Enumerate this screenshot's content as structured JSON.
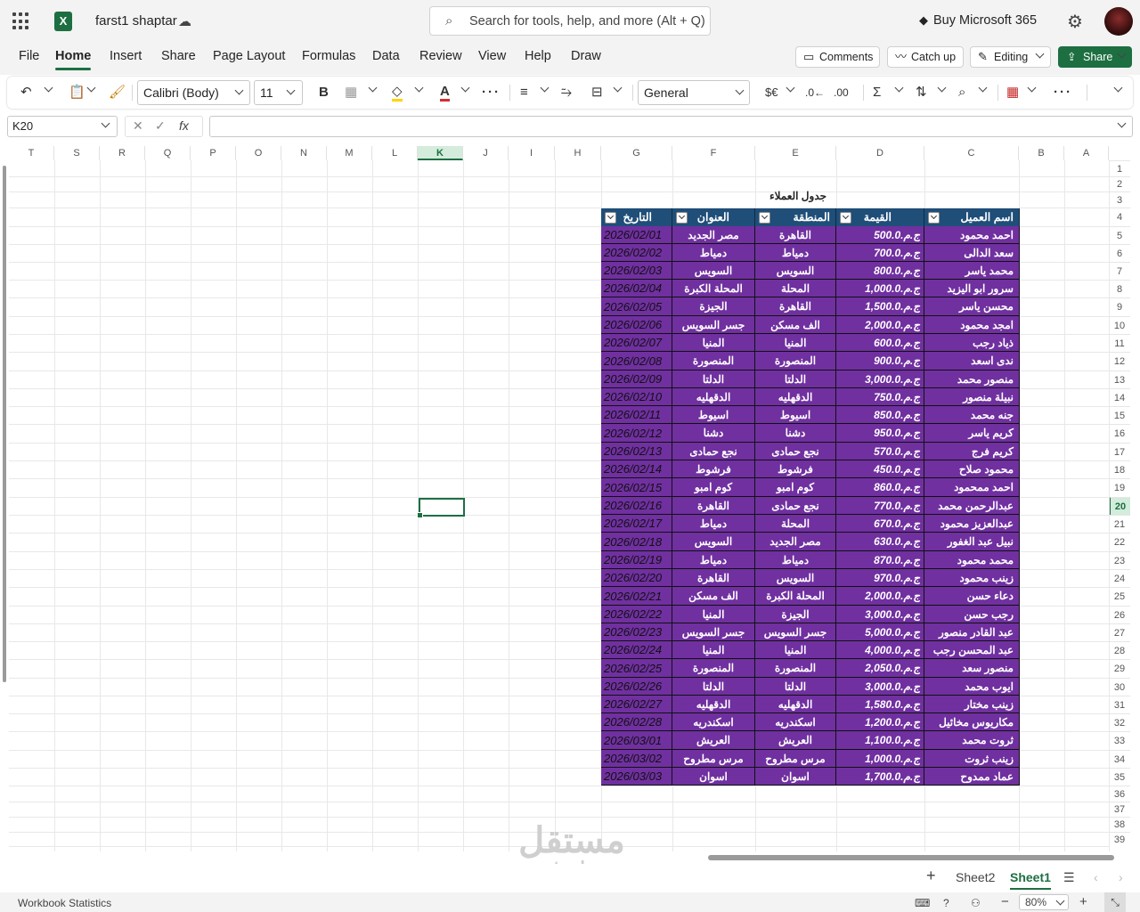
{
  "titlebar": {
    "doc_title": "farst1 shaptar",
    "search_placeholder": "Search for tools, help, and more (Alt + Q)",
    "buy_label": "Buy Microsoft 365"
  },
  "menu": {
    "items": [
      "File",
      "Home",
      "Insert",
      "Share",
      "Page Layout",
      "Formulas",
      "Data",
      "Review",
      "View",
      "Help",
      "Draw"
    ],
    "active": "Home",
    "comments_label": "Comments",
    "catchup_label": "Catch up",
    "editing_label": "Editing",
    "share_label": "Share"
  },
  "ribbon": {
    "font_name": "Calibri (Body)",
    "font_size": "11",
    "number_format": "General",
    "currency_glyph": "$€"
  },
  "formula_bar": {
    "name_box": "K20",
    "fx_label": "fx",
    "formula": ""
  },
  "grid": {
    "columns": [
      "T",
      "S",
      "R",
      "Q",
      "P",
      "O",
      "N",
      "M",
      "L",
      "K",
      "J",
      "I",
      "H",
      "G",
      "F",
      "E",
      "D",
      "C",
      "B",
      "A"
    ],
    "selected_column": "K",
    "row_count": 39,
    "selected_row": "20"
  },
  "table": {
    "title": "جدول العملاء",
    "headers": {
      "c": "اسم العميل",
      "d": "القيمة",
      "e": "المنطقة",
      "f": "العنوان",
      "g": "التاريخ"
    },
    "rows": [
      {
        "name": "احمد محمود",
        "value": "ج.م.500.0",
        "region": "القاهرة",
        "address": "مصر الجديد",
        "date": "2026/02/01"
      },
      {
        "name": "سعد الدالى",
        "value": "ج.م.700.0",
        "region": "دمياط",
        "address": "دمياط",
        "date": "2026/02/02"
      },
      {
        "name": "محمد ياسر",
        "value": "ج.م.800.0",
        "region": "السويس",
        "address": "السويس",
        "date": "2026/02/03"
      },
      {
        "name": "سرور ابو اليزيد",
        "value": "ج.م.1,000.0",
        "region": "المحلة",
        "address": "المحلة الكبرة",
        "date": "2026/02/04"
      },
      {
        "name": "محسن ياسر",
        "value": "ج.م.1,500.0",
        "region": "القاهرة",
        "address": "الجيزة",
        "date": "2026/02/05"
      },
      {
        "name": "امجد محمود",
        "value": "ج.م.2,000.0",
        "region": "الف مسكن",
        "address": "جسر السويس",
        "date": "2026/02/06"
      },
      {
        "name": "ذياد رجب",
        "value": "ج.م.600.0",
        "region": "المنيا",
        "address": "المنيا",
        "date": "2026/02/07"
      },
      {
        "name": "ندى اسعد",
        "value": "ج.م.900.0",
        "region": "المنصورة",
        "address": "المنصورة",
        "date": "2026/02/08"
      },
      {
        "name": "منصور محمد",
        "value": "ج.م.3,000.0",
        "region": "الدلتا",
        "address": "الدلتا",
        "date": "2026/02/09"
      },
      {
        "name": "نبيلة منصور",
        "value": "ج.م.750.0",
        "region": "الدقهليه",
        "address": "الدقهليه",
        "date": "2026/02/10"
      },
      {
        "name": "جنه محمد",
        "value": "ج.م.850.0",
        "region": "اسيوط",
        "address": "اسيوط",
        "date": "2026/02/11"
      },
      {
        "name": "كريم ياسر",
        "value": "ج.م.950.0",
        "region": "دشنا",
        "address": "دشنا",
        "date": "2026/02/12"
      },
      {
        "name": "كريم فرج",
        "value": "ج.م.570.0",
        "region": "نجع حمادى",
        "address": "نجع حمادى",
        "date": "2026/02/13"
      },
      {
        "name": "محمود صلاح",
        "value": "ج.م.450.0",
        "region": "فرشوط",
        "address": "فرشوط",
        "date": "2026/02/14"
      },
      {
        "name": "احمد ممحمود",
        "value": "ج.م.860.0",
        "region": "كوم امبو",
        "address": "كوم امبو",
        "date": "2026/02/15"
      },
      {
        "name": "عبدالرحمن محمد",
        "value": "ج.م.770.0",
        "region": "نجع حمادى",
        "address": "القاهرة",
        "date": "2026/02/16"
      },
      {
        "name": "عبدالعزيز محمود",
        "value": "ج.م.670.0",
        "region": "المحلة",
        "address": "دمياط",
        "date": "2026/02/17"
      },
      {
        "name": "نبيل عبد الغفور",
        "value": "ج.م.630.0",
        "region": "مصر الجديد",
        "address": "السويس",
        "date": "2026/02/18"
      },
      {
        "name": "محمد محمود",
        "value": "ج.م.870.0",
        "region": "دمياط",
        "address": "دمياط",
        "date": "2026/02/19"
      },
      {
        "name": "زينب محمود",
        "value": "ج.م.970.0",
        "region": "السويس",
        "address": "القاهرة",
        "date": "2026/02/20"
      },
      {
        "name": "دعاء حسن",
        "value": "ج.م.2,000.0",
        "region": "المحلة الكبرة",
        "address": "الف مسكن",
        "date": "2026/02/21"
      },
      {
        "name": "رجب حسن",
        "value": "ج.م.3,000.0",
        "region": "الجيزة",
        "address": "المنيا",
        "date": "2026/02/22"
      },
      {
        "name": "عبد القادر منصور",
        "value": "ج.م.5,000.0",
        "region": "جسر السويس",
        "address": "جسر السويس",
        "date": "2026/02/23"
      },
      {
        "name": "عبد المحسن رجب",
        "value": "ج.م.4,000.0",
        "region": "المنيا",
        "address": "المنيا",
        "date": "2026/02/24"
      },
      {
        "name": "منصور سعد",
        "value": "ج.م.2,050.0",
        "region": "المنصورة",
        "address": "المنصورة",
        "date": "2026/02/25"
      },
      {
        "name": "ايوب محمد",
        "value": "ج.م.3,000.0",
        "region": "الدلتا",
        "address": "الدلتا",
        "date": "2026/02/26"
      },
      {
        "name": "زينب مختار",
        "value": "ج.م.1,580.0",
        "region": "الدقهليه",
        "address": "الدقهليه",
        "date": "2026/02/27"
      },
      {
        "name": "مكاريوس مخائيل",
        "value": "ج.م.1,200.0",
        "region": "اسكندريه",
        "address": "اسكندريه",
        "date": "2026/02/28"
      },
      {
        "name": "ثروت محمد",
        "value": "ج.م.1,100.0",
        "region": "العريش",
        "address": "العريش",
        "date": "2026/03/01"
      },
      {
        "name": "زينب ثروت",
        "value": "ج.م.1,000.0",
        "region": "مرس مطروح",
        "address": "مرس مطروح",
        "date": "2026/03/02"
      },
      {
        "name": "عماد ممدوح",
        "value": "ج.م.1,700.0",
        "region": "اسوان",
        "address": "اسوان",
        "date": "2026/03/03"
      }
    ]
  },
  "watermark": {
    "main": "مستقل",
    "sub": "mostaql.com"
  },
  "sheet_tabs": {
    "tabs": [
      "Sheet2",
      "Sheet1"
    ],
    "active": "Sheet1"
  },
  "status": {
    "left": "Workbook Statistics",
    "zoom": "80%"
  },
  "colors": {
    "header_bg": "#1f4e79",
    "row_bg": "#7030a0",
    "accent": "#1d6f42"
  }
}
